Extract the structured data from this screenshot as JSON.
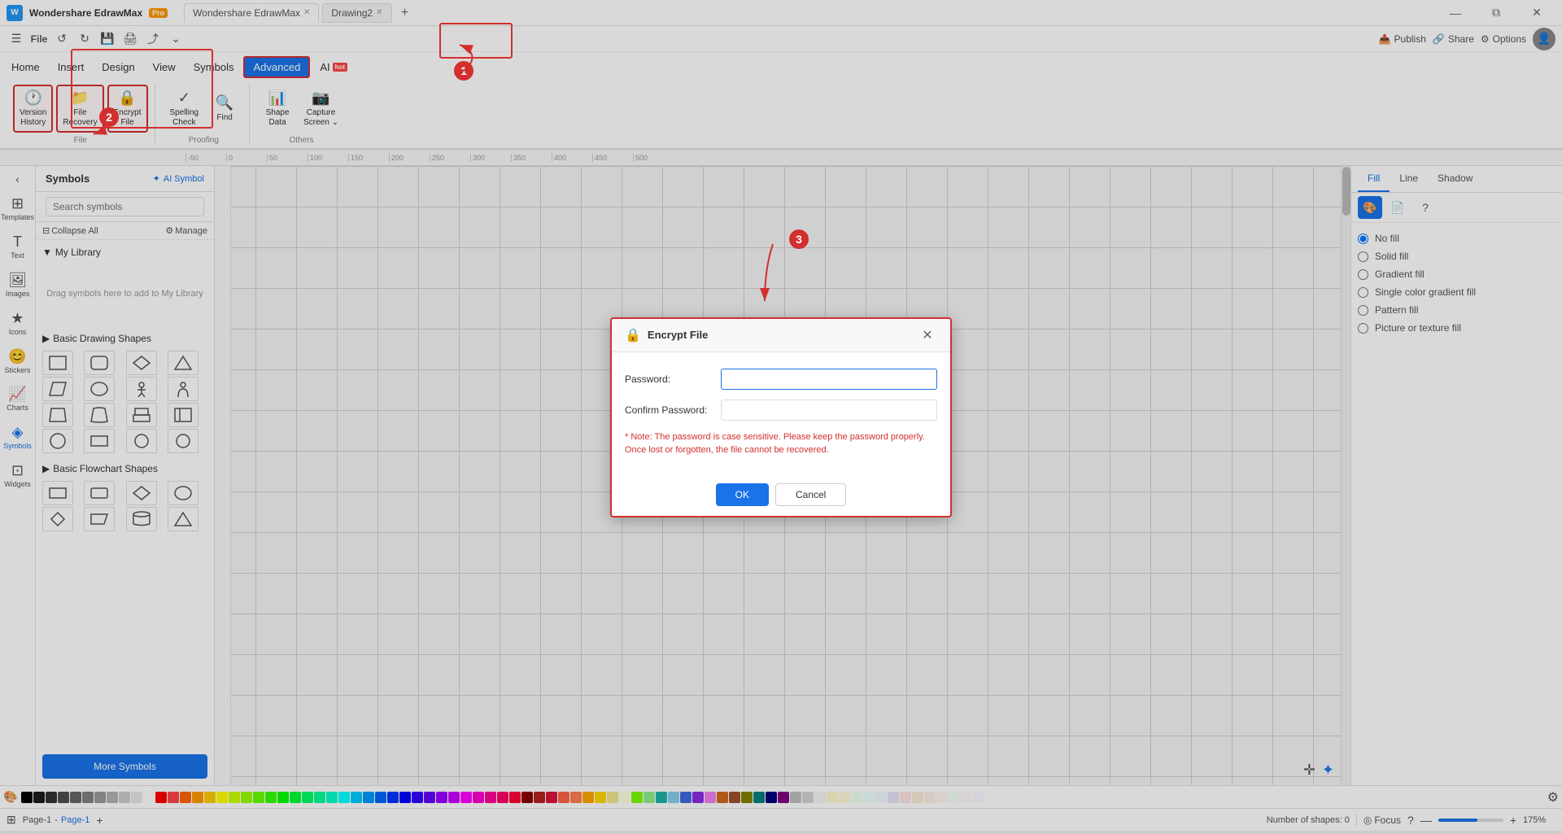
{
  "app": {
    "name": "Wondershare EdrawMax",
    "pro_badge": "Pro",
    "file_name": "Drawing2",
    "icon_text": "W"
  },
  "title_bar": {
    "tabs": [
      {
        "label": "Wondershare EdrawMax",
        "active": true
      },
      {
        "label": "Drawing2",
        "active": false
      }
    ],
    "window_controls": [
      "—",
      "⧉",
      "✕"
    ]
  },
  "quick_access": {
    "buttons": [
      "☰",
      "←",
      "→",
      "💾",
      "🖨",
      "⤴",
      "⌄"
    ]
  },
  "menu": {
    "items": [
      {
        "label": "Home",
        "active": false
      },
      {
        "label": "Insert",
        "active": false
      },
      {
        "label": "Design",
        "active": false
      },
      {
        "label": "View",
        "active": false
      },
      {
        "label": "Symbols",
        "active": false
      },
      {
        "label": "Advanced",
        "active": true
      },
      {
        "label": "AI",
        "active": false,
        "badge": "hot"
      }
    ]
  },
  "ribbon": {
    "groups": [
      {
        "label": "File",
        "buttons": [
          {
            "icon": "🕐",
            "label": "Version\nHistory",
            "highlighted": true
          },
          {
            "icon": "📂",
            "label": "File\nRecovery",
            "highlighted": true
          },
          {
            "icon": "🔒",
            "label": "Encrypt\nFile",
            "highlighted": true
          }
        ]
      },
      {
        "label": "Proofing",
        "buttons": [
          {
            "icon": "✓",
            "label": "Spelling\nCheck"
          },
          {
            "icon": "🔍",
            "label": "Find"
          }
        ]
      },
      {
        "label": "Others",
        "buttons": [
          {
            "icon": "📊",
            "label": "Shape\nData"
          },
          {
            "icon": "📷",
            "label": "Capture\nScreen"
          }
        ]
      }
    ]
  },
  "symbols_panel": {
    "title": "Symbols",
    "ai_symbol_label": "AI Symbol",
    "search_placeholder": "Search symbols",
    "collapse_all_label": "Collapse All",
    "manage_label": "Manage",
    "my_library": {
      "label": "My Library",
      "placeholder_text": "Drag symbols here to add to My Library"
    },
    "sections": [
      {
        "label": "Basic Drawing Shapes"
      },
      {
        "label": "Basic Flowchart Shapes"
      }
    ],
    "more_symbols_label": "More Symbols"
  },
  "right_panel": {
    "tabs": [
      "Fill",
      "Line",
      "Shadow"
    ],
    "active_tab": "Fill",
    "fill_options": [
      {
        "label": "No fill",
        "selected": true
      },
      {
        "label": "Solid fill"
      },
      {
        "label": "Gradient fill"
      },
      {
        "label": "Single color gradient fill"
      },
      {
        "label": "Pattern fill"
      },
      {
        "label": "Picture or texture fill"
      }
    ]
  },
  "encrypt_dialog": {
    "title": "Encrypt File",
    "password_label": "Password:",
    "confirm_password_label": "Confirm Password:",
    "note": "* Note: The password is case sensitive. Please keep the password properly. Once lost or forgotten, the file cannot be recovered.",
    "ok_label": "OK",
    "cancel_label": "Cancel"
  },
  "status_bar": {
    "page_label": "Page-1",
    "page_name": "Page-1",
    "shapes_count": "Number of shapes: 0",
    "focus_label": "Focus",
    "zoom_level": "175%"
  },
  "annotations": {
    "number_1": "1",
    "number_2": "2",
    "number_3": "3"
  },
  "colors": {
    "accent_blue": "#1a73e8",
    "highlight_red": "#d32f2f"
  },
  "color_palette": [
    "#000000",
    "#1a1a1a",
    "#333333",
    "#4d4d4d",
    "#666666",
    "#808080",
    "#999999",
    "#b3b3b3",
    "#cccccc",
    "#e6e6e6",
    "#ffffff",
    "#ff0000",
    "#ff4444",
    "#ff6600",
    "#ff9900",
    "#ffcc00",
    "#ffff00",
    "#ccff00",
    "#99ff00",
    "#66ff00",
    "#33ff00",
    "#00ff00",
    "#00ff33",
    "#00ff66",
    "#00ff99",
    "#00ffcc",
    "#00ffff",
    "#00ccff",
    "#0099ff",
    "#0066ff",
    "#0033ff",
    "#0000ff",
    "#3300ff",
    "#6600ff",
    "#9900ff",
    "#cc00ff",
    "#ff00ff",
    "#ff00cc",
    "#ff0099",
    "#ff0066",
    "#ff0033",
    "#8B0000",
    "#B22222",
    "#DC143C",
    "#FF6347",
    "#FF7F50",
    "#FFA500",
    "#FFD700",
    "#F0E68C",
    "#FFFFE0",
    "#7CFC00",
    "#90EE90",
    "#20B2AA",
    "#87CEEB",
    "#4169E1",
    "#8A2BE2",
    "#EE82EE",
    "#D2691E",
    "#A0522D",
    "#808000",
    "#008080",
    "#000080",
    "#800080",
    "#C0C0C0",
    "#D3D3D3",
    "#F5F5F5",
    "#FFFACD",
    "#FFF8DC",
    "#F0FFF0",
    "#F0FFFF",
    "#F0F8FF",
    "#E6E6FA",
    "#FFE4E1",
    "#FAEBD7",
    "#FAF0E6",
    "#FFF5EE",
    "#F5FFFA",
    "#FFFAFA",
    "#F8F8FF"
  ]
}
